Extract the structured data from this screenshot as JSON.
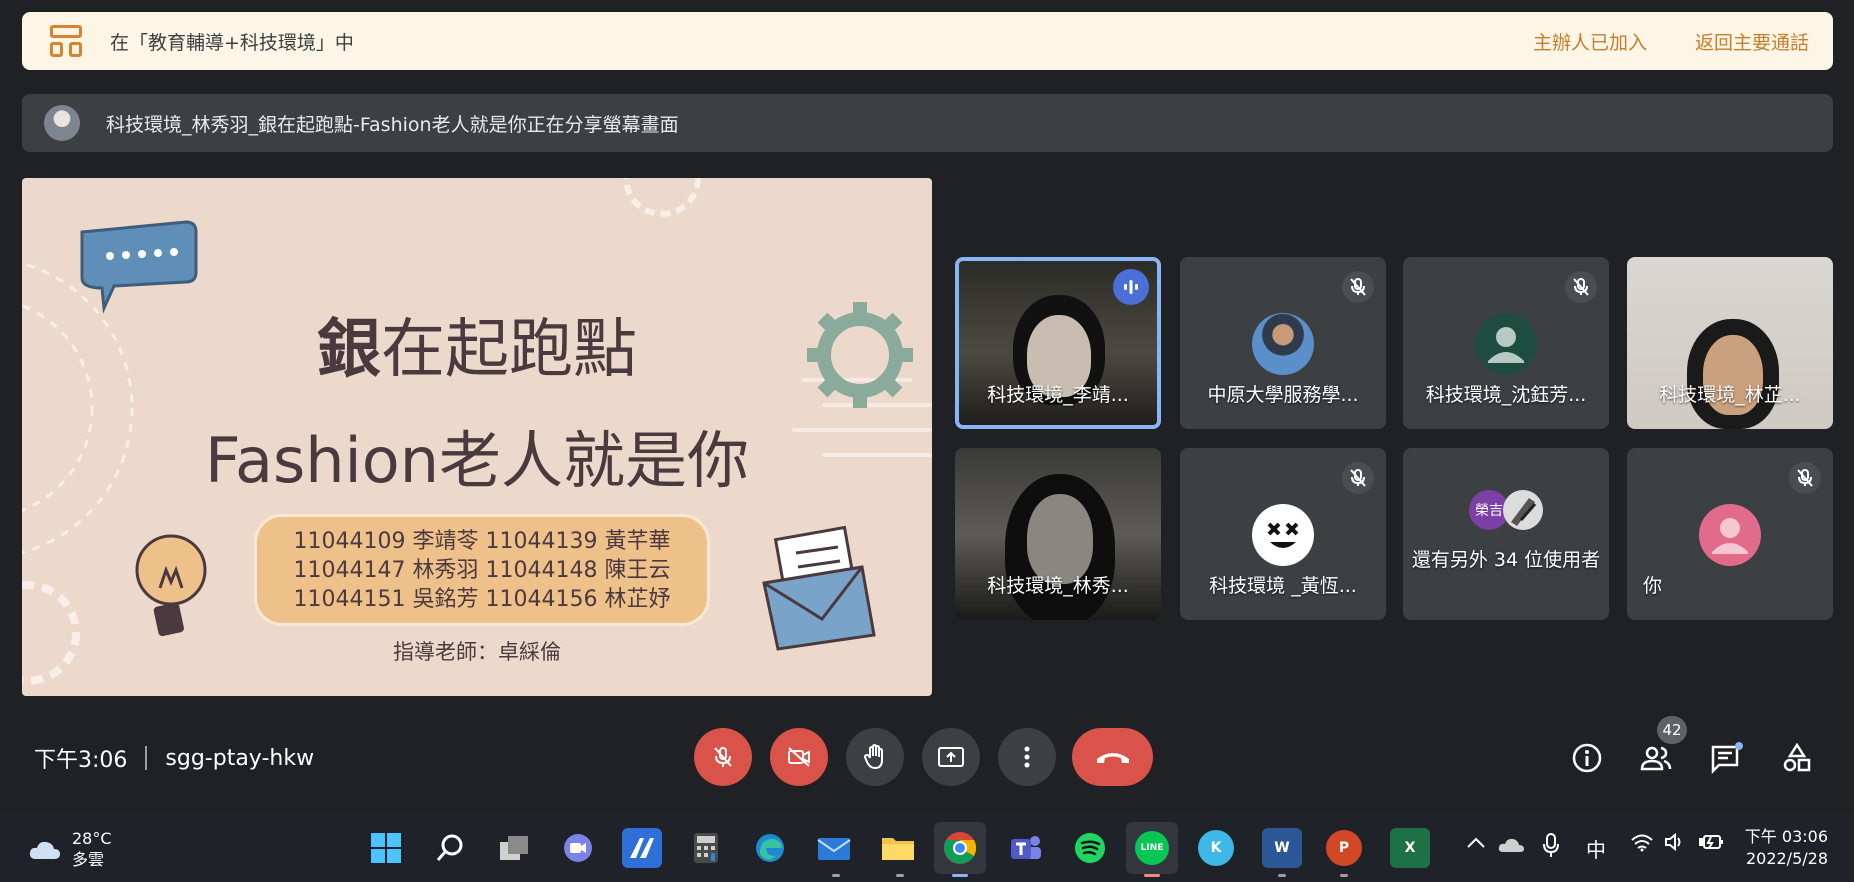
{
  "banner": {
    "text": "在「教育輔導+科技環境」中",
    "host_joined": "主辦人已加入",
    "return_main": "返回主要通話"
  },
  "share_bar": {
    "text": "科技環境_林秀羽_銀在起跑點-Fashion老人就是你正在分享螢幕畫面"
  },
  "slide": {
    "title_bold": "銀",
    "title_rest": "在起跑點",
    "subtitle": "Fashion老人就是你",
    "names": [
      "11044109 李靖苓 11044139 黃芊華",
      "11044147 林秀羽 11044148 陳王云",
      "11044151 吳銘芳 11044156 林芷妤"
    ],
    "teacher": "指導老師：卓綵倫"
  },
  "tiles": [
    {
      "name": "科技環境_李靖...",
      "type": "camera",
      "speaking": true
    },
    {
      "name": "中原大學服務學...",
      "type": "avatar",
      "muted": true,
      "avatar_color": "#5b8fc9"
    },
    {
      "name": "科技環境_沈鈺芳...",
      "type": "avatar",
      "muted": true,
      "avatar_color": "#1e4d3f"
    },
    {
      "name": "科技環境_林芷...",
      "type": "camera"
    },
    {
      "name": "科技環境_林秀...",
      "type": "camera"
    },
    {
      "name": "科技環境 _黃恆...",
      "type": "avatar",
      "muted": true,
      "avatar_color": "#ffffff"
    },
    {
      "name": "還有另外 34 位使用者",
      "type": "others",
      "chip": "榮吉"
    },
    {
      "name": "你",
      "type": "avatar",
      "muted": true,
      "avatar_color": "#e06b8b"
    }
  ],
  "meeting": {
    "time": "下午3:06",
    "code": "sgg-ptay-hkw",
    "participants_count": "42"
  },
  "controls": [
    "mic-off",
    "camera-off",
    "raise-hand",
    "present",
    "more",
    "leave-call"
  ],
  "taskbar": {
    "weather_temp": "28°C",
    "weather_desc": "多雲",
    "ime": "中",
    "clock_time": "下午 03:06",
    "clock_date": "2022/5/28",
    "apps": [
      "start",
      "search",
      "task-view",
      "chat",
      "app-a",
      "calculator",
      "edge",
      "mail",
      "file-explorer",
      "chrome",
      "teams",
      "spotify",
      "line",
      "k-app",
      "word",
      "powerpoint",
      "excel"
    ],
    "app_labels": {
      "line": "LINE",
      "word": "W",
      "powerpoint": "P",
      "excel": "X",
      "k-app": "K"
    }
  },
  "colors": {
    "accent_red": "#d9534a",
    "banner_bg": "#fdf6e7",
    "banner_accent": "#c97d28",
    "speaking_border": "#8ab4f8"
  }
}
